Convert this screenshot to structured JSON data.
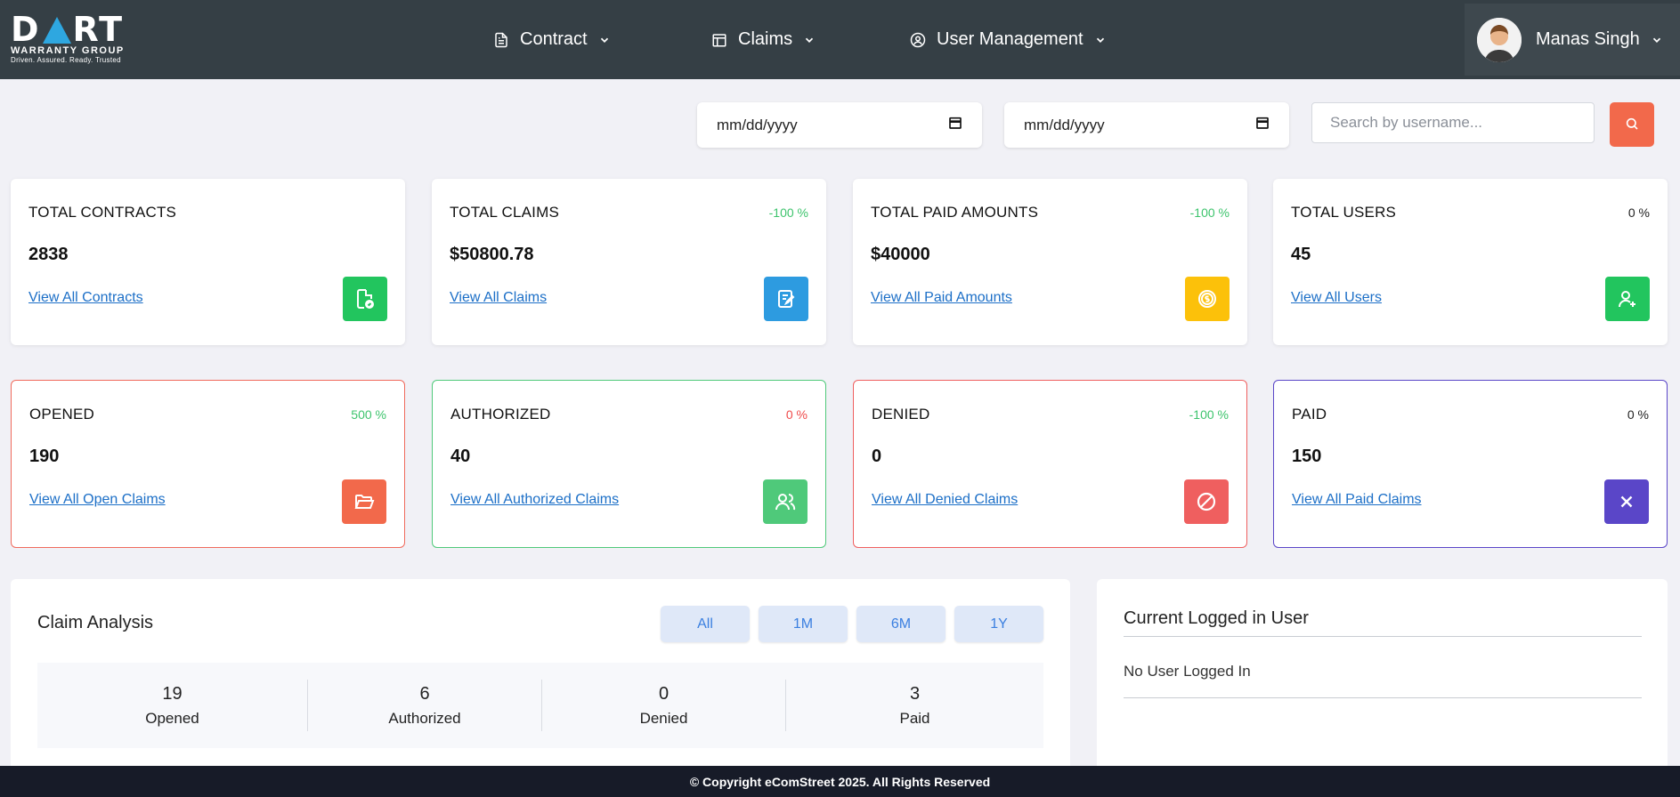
{
  "header": {
    "logo": {
      "brand_left": "D",
      "brand_right": "RT",
      "line1": "WARRANTY GROUP",
      "line2": "Driven. Assured. Ready. Trusted"
    },
    "nav": [
      {
        "label": "Contract",
        "icon": "document-icon"
      },
      {
        "label": "Claims",
        "icon": "calendar-icon"
      },
      {
        "label": "User Management",
        "icon": "user-circle-icon"
      }
    ],
    "user": {
      "name": "Manas Singh"
    }
  },
  "filters": {
    "date_from": "mm/dd/yyyy",
    "date_to": "mm/dd/yyyy",
    "search_placeholder": "Search by username..."
  },
  "summary_cards": [
    {
      "title": "TOTAL CONTRACTS",
      "value": "2838",
      "percent": "",
      "link": "View All Contracts",
      "icon": "file-check-icon",
      "color": "#22c55e"
    },
    {
      "title": "TOTAL CLAIMS",
      "value": "$50800.78",
      "percent": "-100 %",
      "link": "View All Claims",
      "icon": "edit-note-icon",
      "color": "#2d9be0"
    },
    {
      "title": "TOTAL PAID AMOUNTS",
      "value": "$40000",
      "percent": "-100 %",
      "link": "View All Paid Amounts",
      "icon": "coin-icon",
      "color": "#fcc10a"
    },
    {
      "title": "TOTAL USERS",
      "value": "45",
      "percent": "0 %",
      "link": "View All Users",
      "icon": "user-plus-icon",
      "color": "#22c55e"
    }
  ],
  "status_cards": [
    {
      "title": "OPENED",
      "value": "190",
      "percent": "500 %",
      "link": "View All Open Claims",
      "icon": "folder-open-icon",
      "color": "#f2694b",
      "border": "#f06a5c",
      "pct_color": "#3ec46d"
    },
    {
      "title": "AUTHORIZED",
      "value": "40",
      "percent": "0 %",
      "link": "View All Authorized Claims",
      "icon": "users-icon",
      "color": "#4fc97a",
      "border": "#4fc97a",
      "pct_color": "#ef4a4a"
    },
    {
      "title": "DENIED",
      "value": "0",
      "percent": "-100 %",
      "link": "View All Denied Claims",
      "icon": "ban-icon",
      "color": "#ef5f5f",
      "border": "#ef5f5f",
      "pct_color": "#3ec46d"
    },
    {
      "title": "PAID",
      "value": "150",
      "percent": "0 %",
      "link": "View All Paid Claims",
      "icon": "close-icon",
      "color": "#5a46c8",
      "border": "#5a46c8",
      "pct_color": "#222222"
    }
  ],
  "analysis": {
    "title": "Claim Analysis",
    "periods": [
      "All",
      "1M",
      "6M",
      "1Y"
    ],
    "stats": [
      {
        "value": "19",
        "label": "Opened"
      },
      {
        "value": "6",
        "label": "Authorized"
      },
      {
        "value": "0",
        "label": "Denied"
      },
      {
        "value": "3",
        "label": "Paid"
      }
    ]
  },
  "current_user": {
    "title": "Current Logged in User",
    "message": "No User Logged In"
  },
  "footer": {
    "text": "© Copyright eComStreet 2025. All Rights Reserved"
  }
}
